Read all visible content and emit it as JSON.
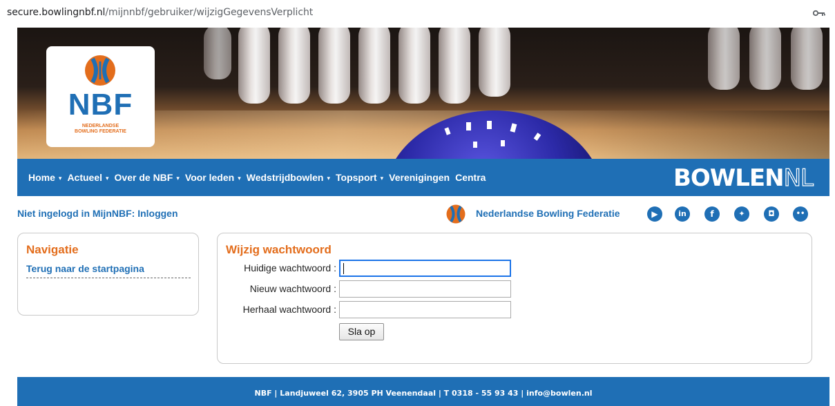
{
  "browser": {
    "url_domain": "secure.bowlingnbf.nl",
    "url_path": "/mijnnbf/gebruiker/wijzigGegevensVerplicht",
    "key_icon": "key-icon"
  },
  "header": {
    "logo": {
      "title": "NBF",
      "subtitle_line1": "NEDERLANDSE",
      "subtitle_line2": "BOWLING FEDERATIE"
    }
  },
  "nav": {
    "items": [
      {
        "label": "Home",
        "dropdown": true
      },
      {
        "label": "Actueel",
        "dropdown": true
      },
      {
        "label": "Over de NBF",
        "dropdown": true
      },
      {
        "label": "Voor leden",
        "dropdown": true
      },
      {
        "label": "Wedstrijdbowlen",
        "dropdown": true
      },
      {
        "label": "Topsport",
        "dropdown": true
      },
      {
        "label": "Verenigingen",
        "dropdown": false
      },
      {
        "label": "Centra",
        "dropdown": false
      }
    ],
    "caret": "▾",
    "brand_main": "BOWLEN",
    "brand_suffix": "NL"
  },
  "info": {
    "login_text": "Niet ingelogd in MijnNBF: Inloggen",
    "federation_name": "Nederlandse Bowling Federatie",
    "social_icons": [
      "youtube-icon",
      "linkedin-icon",
      "facebook-icon",
      "twitter-icon",
      "instagram-icon",
      "flickr-icon"
    ]
  },
  "sidebar": {
    "title": "Navigatie",
    "link": "Terug naar de startpagina"
  },
  "form": {
    "title": "Wijzig wachtwoord",
    "fields": [
      {
        "label": "Huidige wachtwoord :",
        "value": ""
      },
      {
        "label": "Nieuw wachtwoord :",
        "value": ""
      },
      {
        "label": "Herhaal wachtwoord :",
        "value": ""
      }
    ],
    "submit_label": "Sla op"
  },
  "footer": {
    "text": "NBF  |  Landjuweel 62, 3905 PH Veenendaal  |  T 0318 - 55 93 43  |  info@bowlen.nl"
  },
  "colors": {
    "brand_blue": "#1f6fb5",
    "accent_orange": "#e36d1c"
  }
}
